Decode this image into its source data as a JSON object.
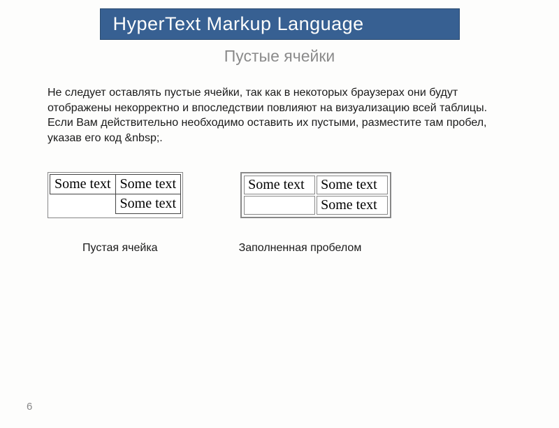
{
  "header": {
    "title": "HyperText Markup Language"
  },
  "subtitle": "Пустые ячейки",
  "paragraph": "Не следует оставлять пустые ячейки, так как в некоторых браузерах они будут отображены некорректно и впоследствии повлияют на визуализацию всей таблицы.\nЕсли Вам действительно необходимо оставить их пустыми, разместите там пробел, указав его код &nbsp;.",
  "table_left": {
    "r1c1": "Some text",
    "r1c2": "Some text",
    "r2c1": "",
    "r2c2": "Some text"
  },
  "table_right": {
    "r1c1": "Some text",
    "r1c2": "Some text",
    "r2c1": " ",
    "r2c2": "Some text"
  },
  "captions": {
    "left": "Пустая ячейка",
    "right": "Заполненная пробелом"
  },
  "page_number": "6"
}
